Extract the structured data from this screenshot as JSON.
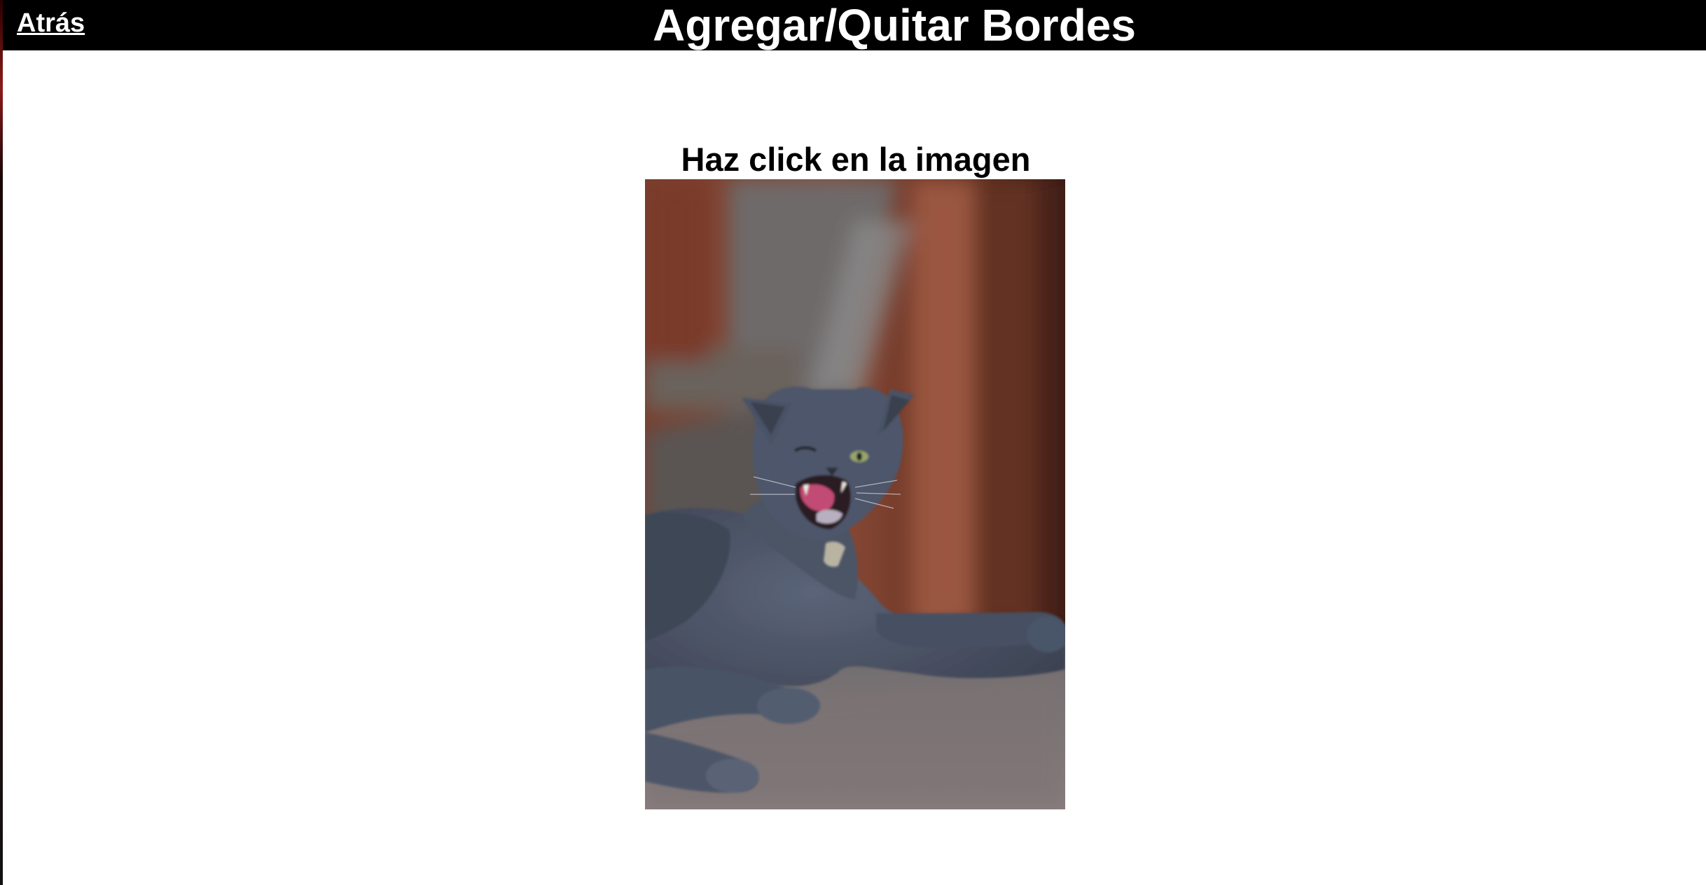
{
  "header": {
    "back_label": "Atrás",
    "title": "Agregar/Quitar Bordes"
  },
  "main": {
    "instruction": "Haz click en la imagen",
    "image": {
      "subject": "gray cat yawning",
      "alt": ""
    }
  },
  "colors": {
    "header_bg": "#000000",
    "header_text": "#ffffff",
    "page_bg": "#ffffff"
  }
}
